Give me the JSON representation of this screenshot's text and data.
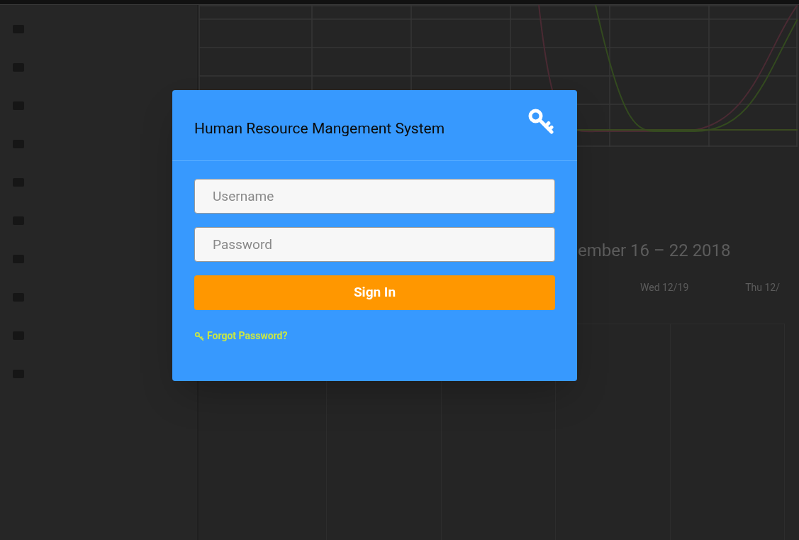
{
  "background": {
    "calendar": {
      "title": "ember 16 – 22 2018",
      "columns": [
        "Wed 12/19",
        "Thu 12/"
      ]
    }
  },
  "dialog": {
    "title": "Human Resource Mangement System",
    "fields": [
      {
        "placeholder": "Username"
      },
      {
        "placeholder": "Password"
      }
    ],
    "submit": "Sign In",
    "forgot_link": "Forgot Password?"
  }
}
